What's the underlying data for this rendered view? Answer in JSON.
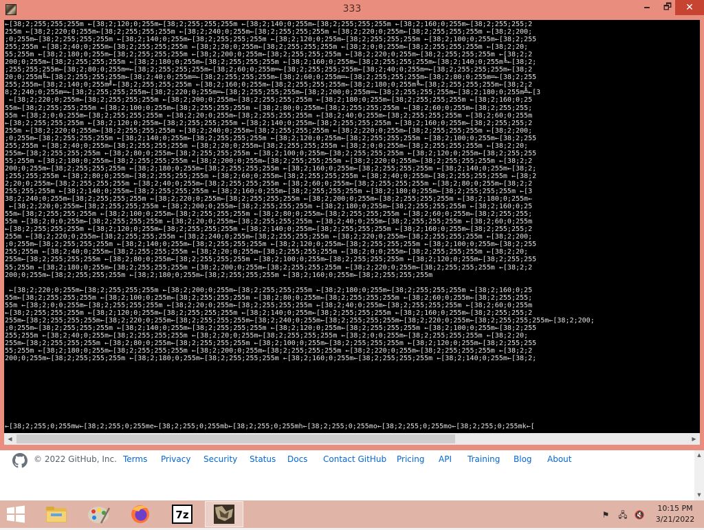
{
  "window": {
    "title": "333",
    "minimize_glyph": "🗕",
    "maximize_glyph": "🗗",
    "close_glyph": "✕"
  },
  "console": {
    "lines": [
      "←[38;2;255;255;255m ←[38;2;120;0;255m←[38;2;255;255;255m ←[38;2;140;0;255m←[38;2;255;255;255m ←[38;2;160;0;255m←[38;2;255;255;2",
      "255m ←[38;2;220;0;255m←[38;2;255;255;255m ←[38;2;240;0;255m←[38;2;255;255;255m ←[38;2;220;0;255m←[38;2;255;255;255m ←[38;2;200;",
      ";0;255m←[38;2;255;255;255m ←[38;2;140;0;255m←[38;2;255;255;255m ←[38;2;120;0;255m←[38;2;255;255;255m ←[38;2;100;0;255m←[38;2;255",
      "255;255m ←[38;2;40;0;255m←[38;2;255;255;255m ←[38;2;20;0;255m←[38;2;255;255;255m ←[38;2;0;0;255m←[38;2;255;255;255m ←[38;2;20;",
      "55;255m ←[38;2;180;0;255m←[38;2;255;255;255m ←[38;2;200;0;255m←[38;2;255;255;255m ←[38;2;220;0;255m←[38;2;255;255;255m ←[38;2;2",
      "200;0;255m←[38;2;255;255;255m ←[38;2;180;0;255m←[38;2;255;255;255m ←[38;2;160;0;255m←[38;2;255;255;255m←[38;2;140;0;255m╚←[38;2;",
      ";255;255;255m←[38;2;80;0;255m═←[38;2;255;255;255m←[38;2;60;0;255m═←[38;2;255;255;255m←[38;2;40;0;255m═←[38;2;255;255;255m←[38;2",
      "20;0;255m╚←[38;2;255;255;255m←[38;2;40;0;255m═←[38;2;255;255;255m←[38;2;60;0;255m═←[38;2;255;255;255m←[38;2;80;0;255m═←[38;2;255",
      "255;255m←[38;2;140;0;255m╝←[38;2;255;255;255m ←[38;2;160;0;255m←[38;2;255;255;255m←[38;2;180;0;255m╚←[38;2;255;255;255m←[38;2;2",
      "8;2;240;0;255m═←[38;2;255;255;255m←[38;2;220;0;255m═←[38;2;255;255;255m←[38;2;200;0;255m═←[38;2;255;255;255m←[38;2;180;0;255m╩←[3",
      " ←[38;2;220;0;255m←[38;2;255;255;255m ←[38;2;200;0;255m←[38;2;255;255;255m ←[38;2;180;0;255m←[38;2;255;255;255m ←[38;2;160;0;25",
      "55m←[38;2;255;255;255m ←[38;2;100;0;255m←[38;2;255;255;255m ←[38;2;80;0;255m←[38;2;255;255;255m ←[38;2;60;0;255m←[38;2;255;255;",
      "55m ←[38;2;0;0;255m←[38;2;255;255;255m ←[38;2;20;0;255m←[38;2;255;255;255m ←[38;2;40;0;255m←[38;2;255;255;255m ←[38;2;60;0;255m",
      "←[38;2;255;255;255m ←[38;2;120;0;255m←[38;2;255;255;255m ←[38;2;140;0;255m←[38;2;255;255;255m ←[38;2;160;0;255m←[38;2;255;255;2",
      "255m ←[38;2;220;0;255m←[38;2;255;255;255m ←[38;2;240;0;255m←[38;2;255;255;255m ←[38;2;220;0;255m←[38;2;255;255;255m ←[38;2;200;",
      ";0;255m←[38;2;255;255;255m ←[38;2;140;0;255m←[38;2;255;255;255m ←[38;2;120;0;255m←[38;2;255;255;255m ←[38;2;100;0;255m←[38;2;255",
      "255;255m ←[38;2;40;0;255m←[38;2;255;255;255m ←[38;2;20;0;255m←[38;2;255;255;255m ←[38;2;0;0;255m←[38;2;255;255;255m ←[38;2;20;",
      "255m←[38;2;255;255;255m ←[38;2;80;0;255m←[38;2;255;255;255m ←[38;2;100;0;255m←[38;2;255;255;255m ←[38;2;120;0;255m←[38;2;255;255",
      "55;255m ←[38;2;180;0;255m←[38;2;255;255;255m ←[38;2;200;0;255m←[38;2;255;255;255m ←[38;2;220;0;255m←[38;2;255;255;255m ←[38;2;2",
      "200;0;255m←[38;2;255;255;255m ←[38;2;180;0;255m←[38;2;255;255;255m ←[38;2;160;0;255m←[38;2;255;255;255m ←[38;2;140;0;255m←[38;2;",
      ";255;255;255m ←[38;2;80;0;255m←[38;2;255;255;255m ←[38;2;60;0;255m←[38;2;255;255;255m ←[38;2;40;0;255m←[38;2;255;255;255m ←[38;2",
      "2;20;0;255m←[38;2;255;255;255m ←[38;2;40;0;255m←[38;2;255;255;255m ←[38;2;60;0;255m←[38;2;255;255;255m ←[38;2;80;0;255m←[38;2;2",
      "255;255;255m ←[38;2;140;0;255m←[38;2;255;255;255m ←[38;2;160;0;255m←[38;2;255;255;255m ←[38;2;180;0;255m←[38;2;255;255;255m ←[3",
      "38;2;240;0;255m←[38;2;255;255;255m ←[38;2;220;0;255m←[38;2;255;255;255m ←[38;2;200;0;255m←[38;2;255;255;255m ←[38;2;180;0;255m←",
      " ←[38;2;220;0;255m←[38;2;255;255;255m ←[38;2;200;0;255m←[38;2;255;255;255m ←[38;2;180;0;255m←[38;2;255;255;255m ←[38;2;160;0;25",
      "55m←[38;2;255;255;255m ←[38;2;100;0;255m←[38;2;255;255;255m ←[38;2;80;0;255m←[38;2;255;255;255m ←[38;2;60;0;255m←[38;2;255;255;",
      "55m ←[38;2;0;0;255m←[38;2;255;255;255m ←[38;2;20;0;255m←[38;2;255;255;255m ←[38;2;40;0;255m←[38;2;255;255;255m ←[38;2;60;0;255m",
      "←[38;2;255;255;255m ←[38;2;120;0;255m←[38;2;255;255;255m ←[38;2;140;0;255m←[38;2;255;255;255m ←[38;2;160;0;255m←[38;2;255;255;2",
      "255m ←[38;2;220;0;255m←[38;2;255;255;255m ←[38;2;240;0;255m←[38;2;255;255;255m ←[38;2;220;0;255m←[38;2;255;255;255m ←[38;2;200;",
      ";0;255m←[38;2;255;255;255m ←[38;2;140;0;255m←[38;2;255;255;255m ←[38;2;120;0;255m←[38;2;255;255;255m ←[38;2;100;0;255m←[38;2;255",
      "255;255m ←[38;2;40;0;255m←[38;2;255;255;255m ←[38;2;20;0;255m←[38;2;255;255;255m ←[38;2;0;0;255m←[38;2;255;255;255m ←[38;2;20;",
      "255m←[38;2;255;255;255m ←[38;2;80;0;255m←[38;2;255;255;255m ←[38;2;100;0;255m←[38;2;255;255;255m ←[38;2;120;0;255m←[38;2;255;255",
      "55;255m ←[38;2;180;0;255m←[38;2;255;255;255m ←[38;2;200;0;255m←[38;2;255;255;255m ←[38;2;220;0;255m←[38;2;255;255;255m ←[38;2;2",
      "200;0;255m←[38;2;255;255;255m ←[38;2;180;0;255m←[38;2;255;255;255m ←[38;2;160;0;255m←[38;2;255;255;255m",
      " ←[38;2;220;0;255m←[38;2;255;255;255m ←[38;2;200;0;255m←[38;2;255;255;255m ←[38;2;180;0;255m←[38;2;255;255;255m ←[38;2;160;0;25",
      "55m←[38;2;255;255;255m ←[38;2;100;0;255m←[38;2;255;255;255m ←[38;2;80;0;255m←[38;2;255;255;255m ←[38;2;60;0;255m←[38;2;255;255;",
      "55m ←[38;2;0;0;255m←[38;2;255;255;255m ←[38;2;20;0;255m←[38;2;255;255;255m ←[38;2;40;0;255m←[38;2;255;255;255m ←[38;2;60;0;255m",
      "←[38;2;255;255;255m ←[38;2;120;0;255m←[38;2;255;255;255m ←[38;2;140;0;255m←[38;2;255;255;255m ←[38;2;160;0;255m←[38;2;255;255;2",
      "255m←[38;2;255;255;255m←[38;2;220;0;255m←[38;2;255;255;255m←[38;2;240;0;255m←[38;2;255;255;255m←[38;2;220;0;255m←[38;2;255;255;255m←[38;2;200;",
      ";0;255m←[38;2;255;255;255m ←[38;2;140;0;255m←[38;2;255;255;255m ←[38;2;120;0;255m←[38;2;255;255;255m ←[38;2;100;0;255m←[38;2;255",
      "255;255m ←[38;2;40;0;255m←[38;2;255;255;255m ←[38;2;20;0;255m←[38;2;255;255;255m ←[38;2;0;0;255m←[38;2;255;255;255m ←[38;2;20;",
      "255m←[38;2;255;255;255m ←[38;2;80;0;255m←[38;2;255;255;255m ←[38;2;100;0;255m←[38;2;255;255;255m ←[38;2;120;0;255m←[38;2;255;255",
      "55;255m ←[38;2;180;0;255m←[38;2;255;255;255m ←[38;2;200;0;255m←[38;2;255;255;255m ←[38;2;220;0;255m←[38;2;255;255;255m ←[38;2;2",
      "200;0;255m←[38;2;255;255;255m ←[38;2;180;0;255m←[38;2;255;255;255m ←[38;2;160;0;255m←[38;2;255;255;255m ←[38;2;140;0;255m←[38;2;"
    ],
    "status_line": "←[38;2;255;0;255mw←[38;2;255;0;255me←[38;2;255;0;255mb←[38;2;255;0;255mh←[38;2;255;0;255mo←[38;2;255;0;255mo←[38;2;255;0;255mk←["
  },
  "footer": {
    "copyright": "© 2022 GitHub, Inc.",
    "links": [
      "Terms",
      "Privacy",
      "Security",
      "Status",
      "Docs",
      "Contact GitHub",
      "Pricing",
      "API",
      "Training",
      "Blog",
      "About"
    ]
  },
  "taskbar": {
    "items": [
      {
        "name": "file-explorer",
        "label": "File Explorer"
      },
      {
        "name": "paint",
        "label": "Paint"
      },
      {
        "name": "firefox",
        "label": "Firefox"
      },
      {
        "name": "7zip",
        "label": "7z"
      },
      {
        "name": "console-app",
        "label": "333"
      }
    ],
    "time": "10:15 PM",
    "date": "3/21/2022"
  },
  "colors": {
    "window_frame": "#e98e7e",
    "close_button": "#c74433",
    "console_bg": "#000000",
    "link": "#0366d6",
    "taskbar": "#e0b4a6"
  }
}
